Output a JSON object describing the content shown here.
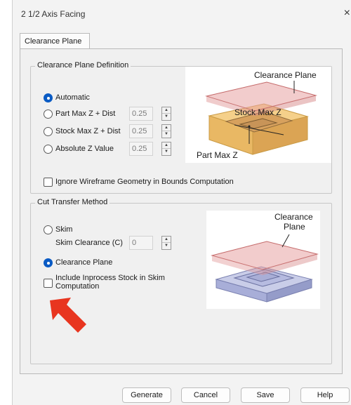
{
  "window": {
    "title": "2 1/2 Axis Facing",
    "close_symbol": "×"
  },
  "tabs": [
    {
      "label": "Clearance Plane",
      "active": true
    }
  ],
  "clearance_plane_definition": {
    "group_label": "Clearance Plane Definition",
    "options": [
      {
        "label": "Automatic",
        "selected": true
      },
      {
        "label": "Part Max Z + Dist",
        "selected": false,
        "value": "0.25"
      },
      {
        "label": "Stock Max Z + Dist",
        "selected": false,
        "value": "0.25"
      },
      {
        "label": "Absolute Z Value",
        "selected": false,
        "value": "0.25"
      }
    ],
    "ignore_wireframe": {
      "label": "Ignore Wireframe Geometry in Bounds Computation",
      "checked": false
    },
    "image_labels": {
      "clearance_plane": "Clearance Plane",
      "stock_max_z": "Stock Max Z",
      "part_max_z": "Part Max Z"
    }
  },
  "cut_transfer_method": {
    "group_label": "Cut Transfer Method",
    "skim": {
      "label": "Skim",
      "selected": false
    },
    "skim_clearance": {
      "label": "Skim Clearance (C)",
      "value": "0"
    },
    "clearance_plane": {
      "label": "Clearance Plane",
      "selected": true
    },
    "include_inprocess": {
      "label_line1": "Include Inprocess Stock in Skim",
      "label_line2": "Computation",
      "checked": false
    },
    "image_labels": {
      "clearance_line1": "Clearance",
      "clearance_line2": "Plane"
    }
  },
  "buttons": {
    "generate": "Generate",
    "cancel": "Cancel",
    "save": "Save",
    "help": "Help"
  },
  "colors": {
    "accent": "#0a5bc4",
    "arrow": "#e8351f",
    "plane": "#e8a3a3",
    "stock": "#f2c27a"
  }
}
